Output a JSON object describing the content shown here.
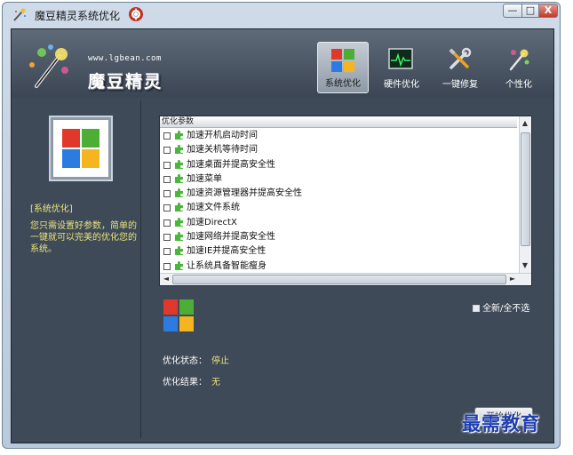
{
  "window": {
    "title": "魔豆精灵系统优化",
    "minimize_glyph": "—",
    "maximize_glyph": "□",
    "close_glyph": "X"
  },
  "header": {
    "site_url": "www.lgbean.com",
    "brand": "魔豆精灵",
    "nav": [
      {
        "label": "系统优化",
        "icon": "windows-flag-icon",
        "active": true
      },
      {
        "label": "硬件优化",
        "icon": "monitor-pulse-icon",
        "active": false
      },
      {
        "label": "一键修复",
        "icon": "tools-icon",
        "active": false
      },
      {
        "label": "个性化",
        "icon": "magic-wand-icon",
        "active": false
      }
    ]
  },
  "left_panel": {
    "section_tag": "[系统优化]",
    "description": "您只需设置好参数，简单的一键就可以完美的优化您的系统。"
  },
  "options": {
    "header": "优化参数",
    "items": [
      {
        "label": "加速开机启动时间",
        "checked": false
      },
      {
        "label": "加速关机等待时间",
        "checked": false
      },
      {
        "label": "加速桌面并提高安全性",
        "checked": false
      },
      {
        "label": "加速菜单",
        "checked": false
      },
      {
        "label": "加速资源管理器并提高安全性",
        "checked": false
      },
      {
        "label": "加速文件系统",
        "checked": false
      },
      {
        "label": "加速DirectX",
        "checked": false
      },
      {
        "label": "加速网络并提高安全性",
        "checked": false
      },
      {
        "label": "加速IE并提高安全性",
        "checked": false
      },
      {
        "label": "让系统具备智能瘦身",
        "checked": false
      }
    ],
    "scroll_up": "▲",
    "scroll_down": "▼",
    "scroll_left": "◄",
    "scroll_right": "►"
  },
  "select_all": {
    "label": "全新/全不选",
    "checked": false
  },
  "status": {
    "label": "优化状态：",
    "value": "停止",
    "result_label": "优化结果：",
    "result_value": "无"
  },
  "start_button": {
    "label": "开始优化"
  },
  "watermark": "最需教育",
  "colors": {
    "accent_yellow": "#e8e27a",
    "panel_dark": "#3f4a58",
    "watermark_blue": "#1f3fb0"
  }
}
